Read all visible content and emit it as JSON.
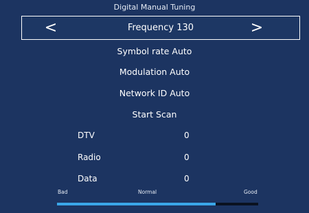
{
  "screen": {
    "title": "Digital Manual Tuning"
  },
  "frequency": {
    "label": "Frequency 130",
    "prev_glyph": "<",
    "next_glyph": ">"
  },
  "menu": {
    "symbol_rate": "Symbol rate Auto",
    "modulation": "Modulation Auto",
    "network_id": "Network ID Auto",
    "start_scan": "Start Scan"
  },
  "results": [
    {
      "label": "DTV",
      "value": "0"
    },
    {
      "label": "Radio",
      "value": "0"
    },
    {
      "label": "Data",
      "value": "0"
    }
  ],
  "signal_quality": {
    "bad_label": "Bad",
    "normal_label": "Normal",
    "good_label": "Good",
    "level_fraction": 0.79
  },
  "colors": {
    "background": "#1c3461",
    "bar_fill": "#3aa6e8",
    "bar_track": "#0a1220"
  }
}
